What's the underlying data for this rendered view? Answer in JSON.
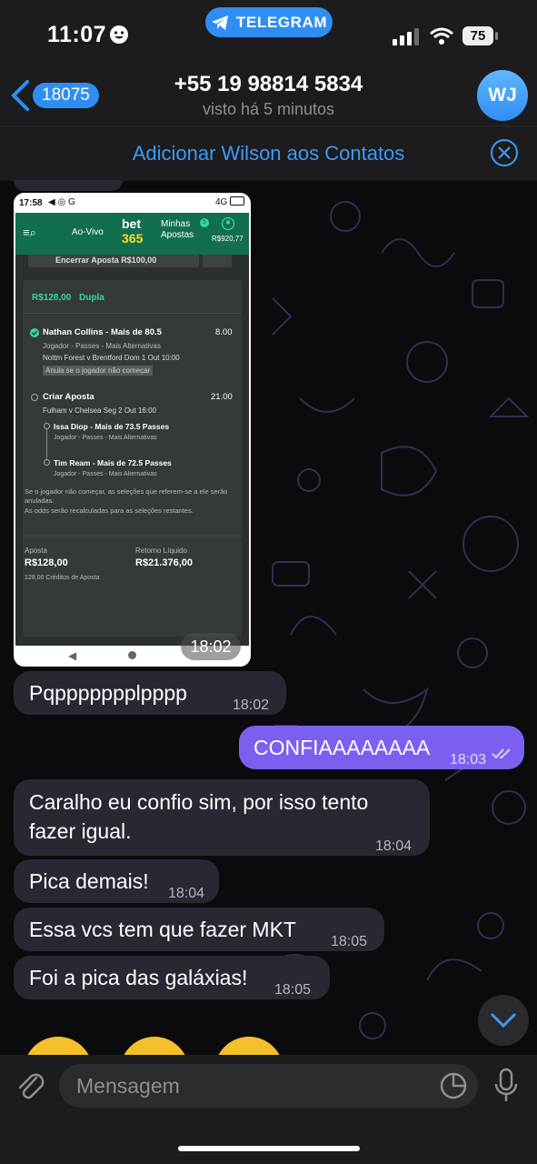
{
  "status_bar": {
    "time": "11:07",
    "app_pill": "TELEGRAM",
    "battery": "75"
  },
  "header": {
    "back_count": "18075",
    "title": "+55 19 98814 5834",
    "subtitle": "visto há 5 minutos",
    "avatar_initials": "WJ"
  },
  "add_contact": {
    "label": "Adicionar Wilson aos Contatos"
  },
  "screenshot": {
    "status_time": "17:58",
    "status_net": "4G",
    "nav": {
      "live": "Ao-Vivo",
      "brand_top": "bet",
      "brand_bottom": "365",
      "my_bets_line1": "Minhas",
      "my_bets_line2": "Apostas",
      "my_bets_badge": "5",
      "balance": "R$920,77"
    },
    "cashout": "Encerrar Aposta R$100,00",
    "bet_header": {
      "stake": "R$128,00",
      "type": "Dupla"
    },
    "sel1": {
      "title": "Nathan Collins - Mais de 80.5",
      "odds": "8.00",
      "market": "Jogador - Passes - Mais Alternativas",
      "event": "Nottm Forest v Brentford  Dom 1 Out 10:00",
      "note": "Anula se o jogador não começar"
    },
    "sel2": {
      "title": "Criar Aposta",
      "odds": "21.00",
      "event": "Fulham v Chelsea  Seg 2 Out 16:00",
      "legs": [
        {
          "title": "Issa Diop - Mais de 73.5 Passes",
          "market": "Jogador - Passes - Mais Alternativas"
        },
        {
          "title": "Tim Ream - Mais de 72.5 Passes",
          "market": "Jogador - Passes - Mais Alternativas"
        }
      ]
    },
    "disclaimer1": "Se o jogador não começar, as seleções que referem-se a ele serão",
    "disclaimer2": "anuladas.",
    "disclaimer3": "As odds serão recalculadas para as seleções restantes.",
    "stake_label": "Aposta",
    "stake_value": "R$128,00",
    "return_label": "Retorno Líquido",
    "return_value": "R$21.376,00",
    "credits": "128,00 Créditos de Aposta",
    "message_time": "18:02"
  },
  "messages": [
    {
      "text": "Pqppppppplpppp",
      "time": "18:02"
    },
    {
      "text": "CONFIAAAAAAAA",
      "time": "18:03"
    },
    {
      "text_line1": "Caralho eu confio sim, por isso tento",
      "text_line2": "fazer igual.",
      "time": "18:04"
    },
    {
      "text": "Pica demais!",
      "time": "18:04"
    },
    {
      "text": "Essa vcs tem que fazer MKT",
      "time": "18:05"
    },
    {
      "text": "Foi a pica das galáxias!",
      "time": "18:05"
    }
  ],
  "composer": {
    "placeholder": "Mensagem"
  },
  "colors": {
    "accent": "#2f8ef2",
    "outgoing": "#7d5ff0",
    "incoming": "#2a2733",
    "bet365_green": "#126e51"
  }
}
